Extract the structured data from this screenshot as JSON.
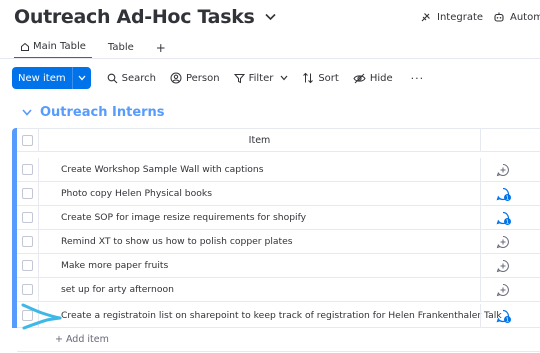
{
  "header": {
    "title": "Outreach Ad-Hoc Tasks",
    "actions": [
      {
        "label": "Integrate",
        "icon": "integrate-icon"
      },
      {
        "label": "Autom",
        "icon": "automate-icon"
      }
    ]
  },
  "tabs": [
    {
      "label": "Main Table",
      "icon": "home-icon",
      "active": true
    },
    {
      "label": "Table",
      "active": false
    },
    {
      "label": "+",
      "active": false
    }
  ],
  "toolbar": {
    "new_item": "New item",
    "search": "Search",
    "person": "Person",
    "filter": "Filter",
    "sort": "Sort",
    "hide": "Hide",
    "more": "···"
  },
  "group": {
    "title": "Outreach Interns",
    "color": "#579bfc",
    "column_item": "Item",
    "rows": [
      {
        "name": "Create Workshop Sample Wall with captions",
        "updates": 0
      },
      {
        "name": "Photo copy Helen Physical books",
        "updates": 1
      },
      {
        "name": "Create SOP for image resize requirements for shopify",
        "updates": 1
      },
      {
        "name": "Remind XT to show us how to polish copper plates",
        "updates": 0
      },
      {
        "name": "Make more paper fruits",
        "updates": 0
      },
      {
        "name": "set up for arty afternoon",
        "updates": 0
      },
      {
        "name": "Create a registratoin list on sharepoint to keep track of registration for Helen Frankenthaler Talk",
        "updates": 1
      }
    ],
    "add_item": "+ Add item"
  },
  "colors": {
    "primary": "#0073ea",
    "annotation_arrow": "#3fb8e8"
  }
}
